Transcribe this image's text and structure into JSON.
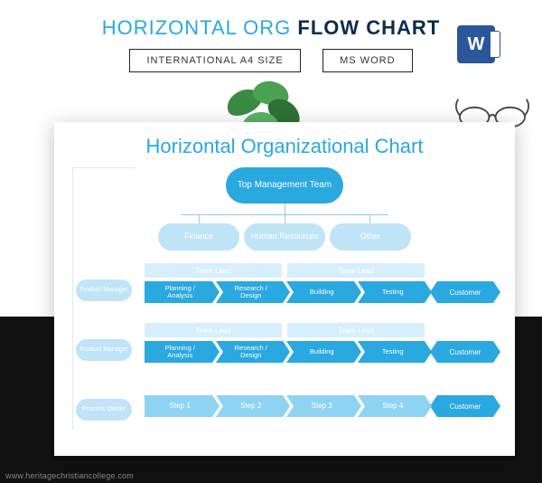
{
  "header": {
    "title_thin": "HORIZONTAL ORG ",
    "title_bold": "FLOW CHART",
    "badge_a4": "INTERNATIONAL A4 SIZE",
    "badge_word": "MS WORD",
    "word_icon_letter": "W"
  },
  "doc": {
    "title": "Horizontal Organizational Chart"
  },
  "chart": {
    "top_management": "Top Management Team",
    "departments": [
      "Finance",
      "Human Resources",
      "Other"
    ],
    "lanes": [
      {
        "role": "Product Manager",
        "team_leads": [
          "Team Lead",
          "Team Lead"
        ],
        "steps": [
          "Planning / Analysis",
          "Research / Design",
          "Building",
          "Testing"
        ],
        "customer": "Customer"
      },
      {
        "role": "Product Manager",
        "team_leads": [
          "Team Lead",
          "Team Lead"
        ],
        "steps": [
          "Planning / Analysis",
          "Research / Design",
          "Building",
          "Testing"
        ],
        "customer": "Customer"
      },
      {
        "role": "Process Owner",
        "team_leads": [],
        "steps": [
          "Step 1",
          "Step 2",
          "Step 3",
          "Step 4"
        ],
        "customer": "Customer"
      }
    ]
  },
  "watermark": "www.heritagechristiancollege.com"
}
